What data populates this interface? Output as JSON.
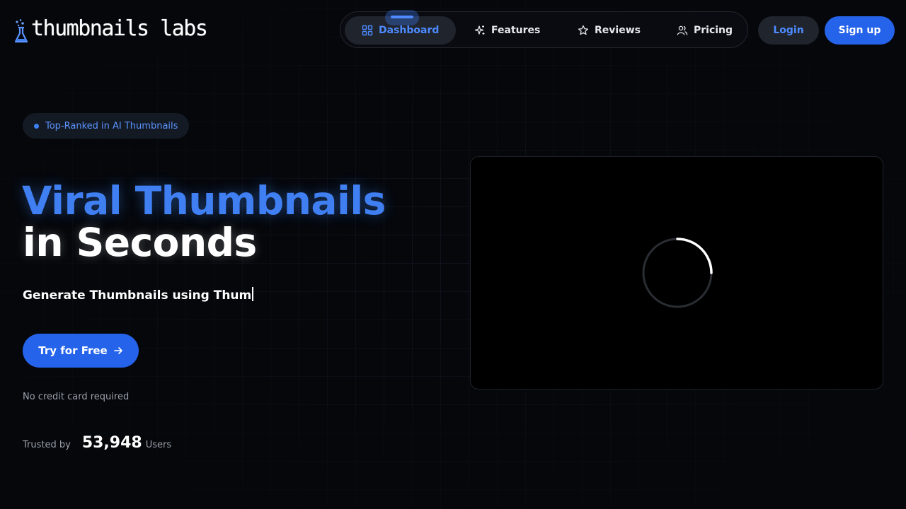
{
  "brand": {
    "name": "thumbnails labs",
    "accent": "#3f7ff2",
    "primary_button": "#2563eb",
    "background": "#05070b"
  },
  "nav": {
    "items": [
      {
        "label": "Dashboard",
        "icon": "grid-icon",
        "active": true
      },
      {
        "label": "Features",
        "icon": "sparkles-icon",
        "active": false
      },
      {
        "label": "Reviews",
        "icon": "star-icon",
        "active": false
      },
      {
        "label": "Pricing",
        "icon": "users-icon",
        "active": false
      }
    ],
    "login_label": "Login",
    "signup_label": "Sign up"
  },
  "hero": {
    "badge": "Top-Ranked in AI Thumbnails",
    "title_line_1": "Viral Thumbnails",
    "title_line_2": "in Seconds",
    "typing_text": "Generate Thumbnails using Thum",
    "cta_label": "Try for Free",
    "cta_icon": "arrow-right-icon",
    "note": "No credit card required",
    "trusted_label": "Trusted by",
    "trusted_count": "53,948",
    "trusted_unit": "Users"
  },
  "preview": {
    "state": "loading",
    "icon": "spinner-icon"
  }
}
